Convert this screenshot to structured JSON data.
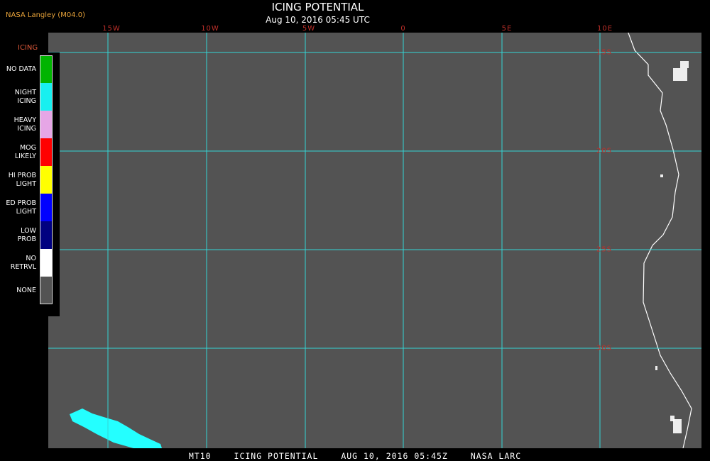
{
  "header": {
    "producer": "NASA Langley (M04.0)",
    "title": "ICING POTENTIAL",
    "subtitle": "Aug 10, 2016 05:45 UTC"
  },
  "map": {
    "background_color": "#535353",
    "grid_color": "#33d6d6",
    "coast_color": "#ffffff",
    "icing_color": "#24ffff",
    "longitude_labels": [
      "15W",
      "10W",
      "5W",
      "0",
      "5E",
      "10E"
    ],
    "latitude_labels": [
      "15S",
      "20S",
      "25S",
      "30S"
    ]
  },
  "legend": {
    "title": "ICING",
    "items": [
      {
        "label": "NO DATA",
        "color": "#00b400"
      },
      {
        "label": "NIGHT\nICING",
        "color": "#18f0f0"
      },
      {
        "label": "HEAVY\nICING",
        "color": "#e6a6e6"
      },
      {
        "label": "MOG\nLIKELY",
        "color": "#ff0000"
      },
      {
        "label": "HI PROB\nLIGHT",
        "color": "#ffff00"
      },
      {
        "label": "ED PROB\nLIGHT",
        "color": "#0000ff"
      },
      {
        "label": "LOW\nPROB",
        "color": "#000080"
      },
      {
        "label": "NO\nRETRVL",
        "color": "#ffffff"
      },
      {
        "label": "NONE",
        "color": "#535353"
      }
    ]
  },
  "footer": {
    "sat": "MT10",
    "product": "ICING POTENTIAL",
    "datetime": "AUG 10, 2016 05:45Z",
    "source": "NASA LARC"
  }
}
